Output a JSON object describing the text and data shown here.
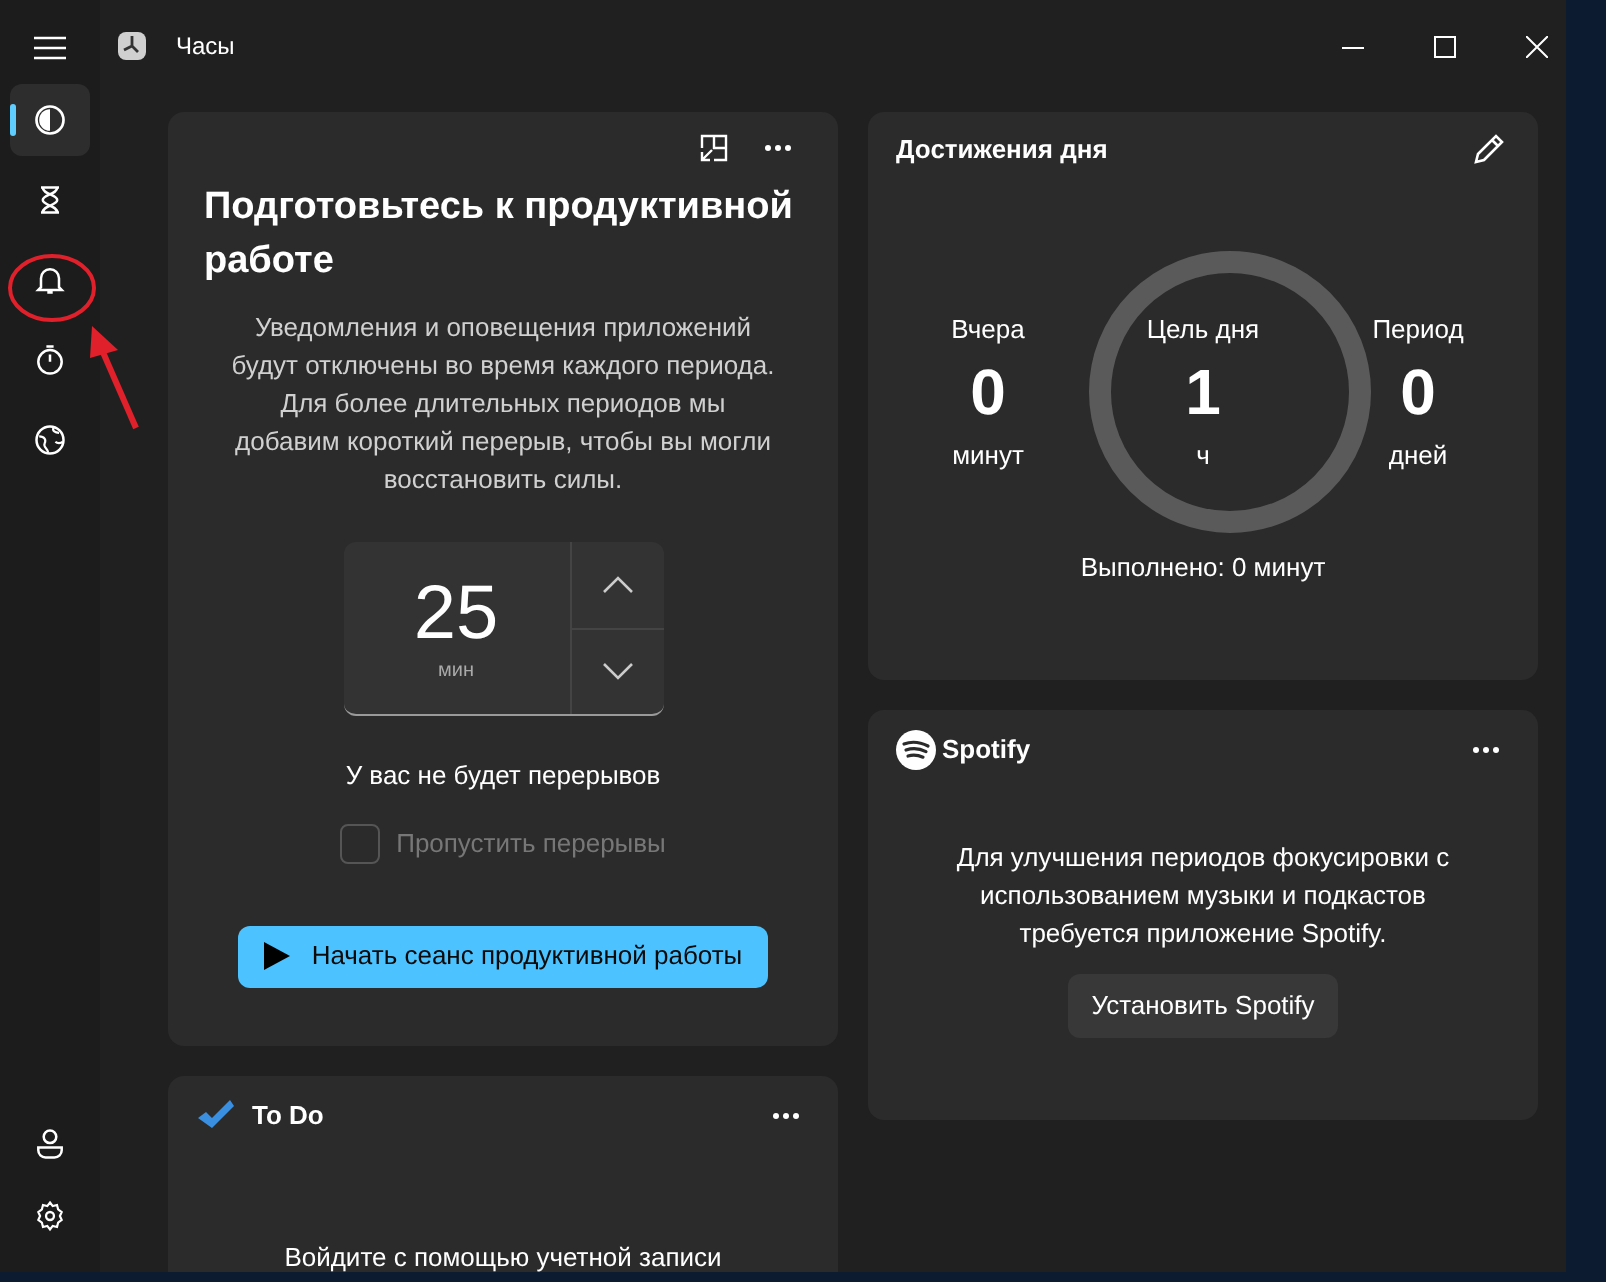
{
  "window": {
    "title": "Часы"
  },
  "sidebar": {
    "items": [
      {
        "kind": "focus",
        "selected": true
      },
      {
        "kind": "timer",
        "selected": false
      },
      {
        "kind": "alarm",
        "selected": false
      },
      {
        "kind": "stopwatch",
        "selected": false
      },
      {
        "kind": "world",
        "selected": false
      }
    ],
    "bottom": [
      {
        "kind": "account"
      },
      {
        "kind": "settings"
      }
    ]
  },
  "focus_card": {
    "title": "Подготовьтесь к продуктивной работе",
    "description": "Уведомления и оповещения приложений будут отключены во время каждого периода. Для более длительных периодов мы добавим короткий перерыв, чтобы вы могли восстановить силы.",
    "minutes": "25",
    "unit": "мин",
    "breaks_note": "У вас не будет перерывов",
    "skip_breaks": {
      "label": "Пропустить перерывы",
      "checked": false,
      "disabled": true
    },
    "start_button": "Начать сеанс продуктивной работы"
  },
  "todo_card": {
    "title": "To Do",
    "message": "Войдите с помощью учетной записи"
  },
  "progress_card": {
    "title": "Достижения дня",
    "stats": [
      {
        "label": "Вчера",
        "value": "0",
        "unit": "минут"
      },
      {
        "label": "Цель дня",
        "value": "1",
        "unit": "ч"
      },
      {
        "label": "Период",
        "value": "0",
        "unit": "дней"
      }
    ],
    "completed": "Выполнено: 0 минут"
  },
  "spotify_card": {
    "logo": "Spotify",
    "message": "Для улучшения периодов фокусировки с использованием музыки и подкастов требуется приложение Spotify.",
    "button": "Установить Spotify"
  }
}
